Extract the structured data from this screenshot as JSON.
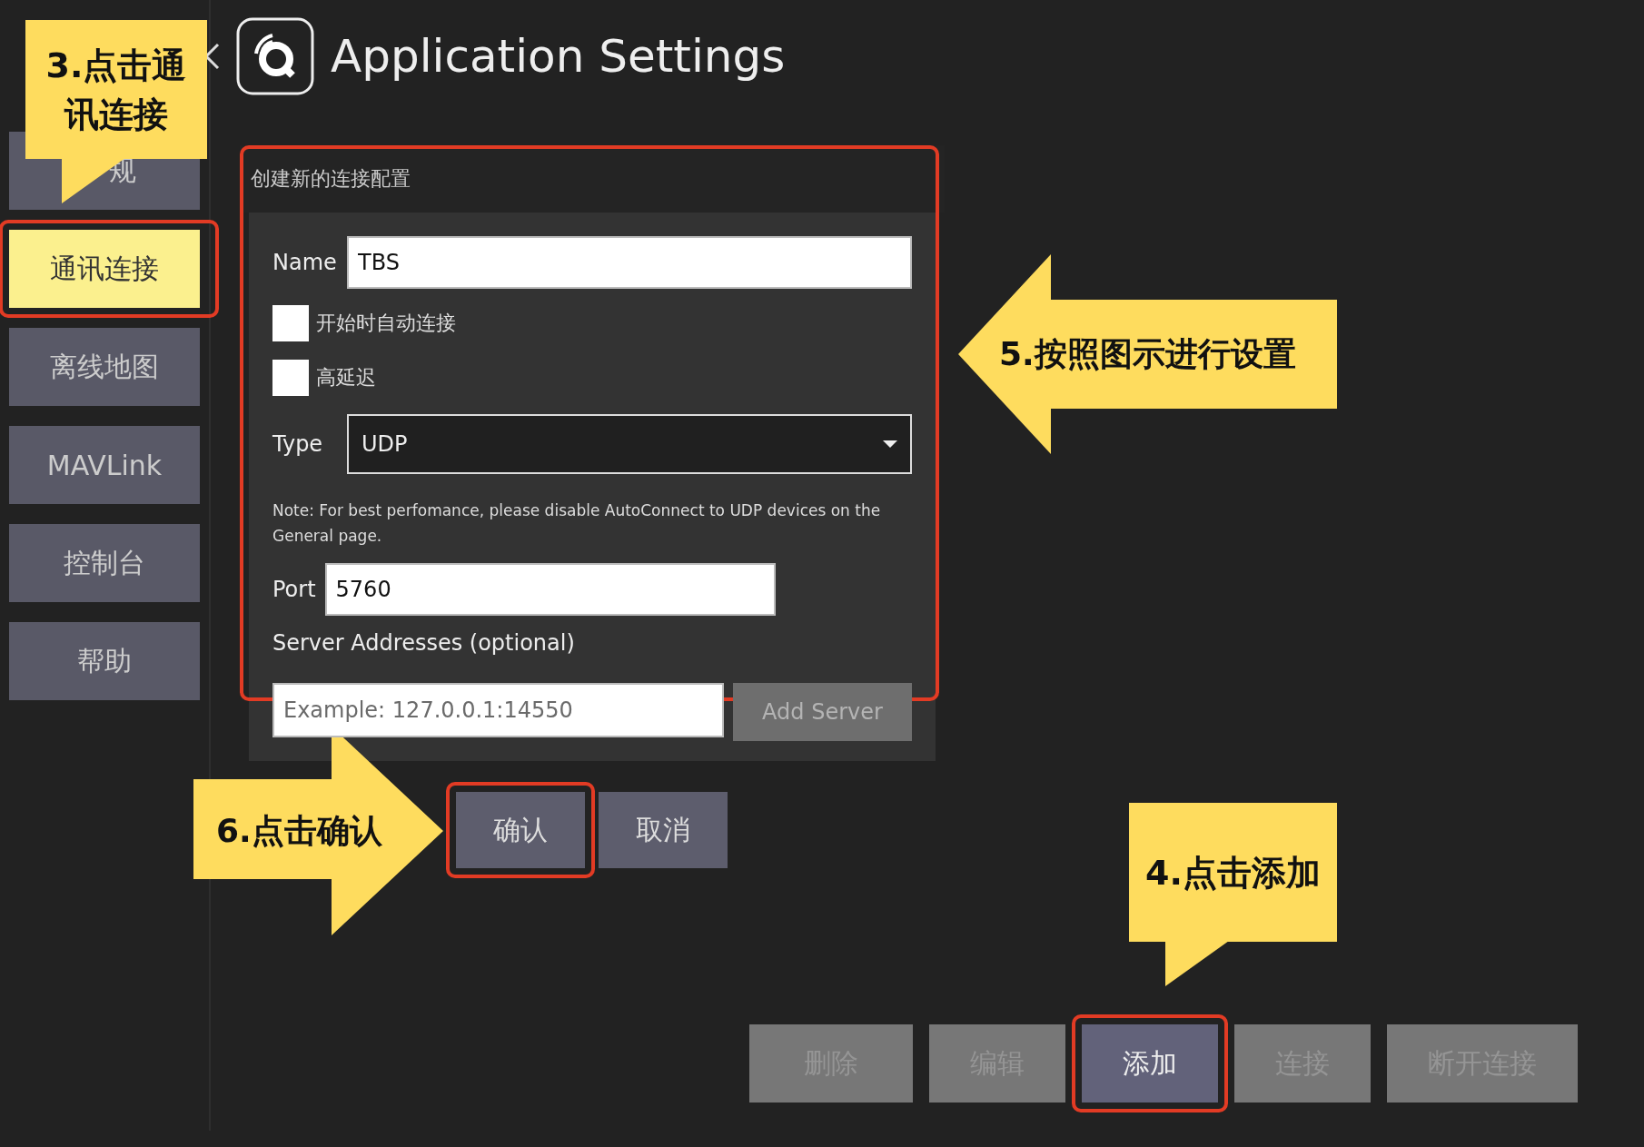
{
  "window": {
    "title": "Application Settings"
  },
  "sidebar": {
    "items": [
      {
        "label": "规",
        "selected": false,
        "highlighted": false
      },
      {
        "label": "通讯连接",
        "selected": true,
        "highlighted": true
      },
      {
        "label": "离线地图",
        "selected": false,
        "highlighted": false
      },
      {
        "label": "MAVLink",
        "selected": false,
        "highlighted": false
      },
      {
        "label": "控制台",
        "selected": false,
        "highlighted": false
      },
      {
        "label": "帮助",
        "selected": false,
        "highlighted": false
      }
    ]
  },
  "dialog": {
    "title": "创建新的连接配置",
    "highlighted": true,
    "name": {
      "label": "Name",
      "value": "TBS"
    },
    "checkboxes": [
      {
        "label": "开始时自动连接",
        "checked": false
      },
      {
        "label": "高延迟",
        "checked": false
      }
    ],
    "type": {
      "label": "Type",
      "value": "UDP"
    },
    "note": "Note: For best perfomance, please disable AutoConnect to UDP devices on the General page.",
    "port": {
      "label": "Port",
      "value": "5760"
    },
    "servers": {
      "label": "Server Addresses (optional)",
      "placeholder": "Example: 127.0.0.1:14550",
      "button": {
        "label": "Add Server",
        "disabled": true
      }
    },
    "buttons": [
      {
        "label": "确认",
        "highlighted": true
      },
      {
        "label": "取消",
        "highlighted": false
      }
    ]
  },
  "actions": [
    {
      "label": "删除",
      "disabled": true,
      "highlighted": false
    },
    {
      "label": "编辑",
      "disabled": true,
      "highlighted": false
    },
    {
      "label": "添加",
      "disabled": false,
      "highlighted": true
    },
    {
      "label": "连接",
      "disabled": true,
      "highlighted": false
    },
    {
      "label": "断开连接",
      "disabled": true,
      "highlighted": false
    }
  ],
  "annotations": [
    {
      "kind": "callout",
      "text": "3.点击通讯连接"
    },
    {
      "kind": "arrow-left",
      "text": "5.按照图示进行设置"
    },
    {
      "kind": "arrow-right",
      "text": "6.点击确认"
    },
    {
      "kind": "callout",
      "text": "4.点击添加"
    }
  ]
}
